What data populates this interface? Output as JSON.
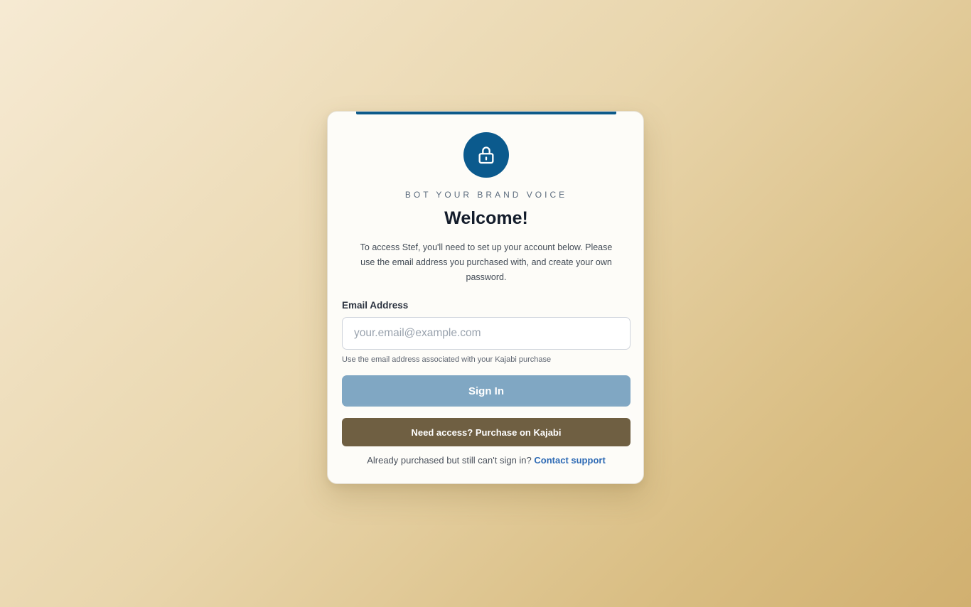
{
  "brand": {
    "tagline": "BOT YOUR BRAND VOICE",
    "accent_color": "#0b5a8d",
    "icon": "lock-icon"
  },
  "welcome": {
    "title": "Welcome!",
    "description": "To access Stef, you'll need to set up your account below. Please use the email address you purchased with, and create your own password."
  },
  "form": {
    "email_label": "Email Address",
    "email_placeholder": "your.email@example.com",
    "email_value": "",
    "email_hint": "Use the email address associated with your Kajabi purchase",
    "signin_label": "Sign In",
    "signin_color": "#80a7c3"
  },
  "purchase": {
    "label": "Need access? Purchase on Kajabi",
    "color": "#6f5f42"
  },
  "support": {
    "prompt": "Already purchased but still can't sign in?",
    "link_label": "Contact support"
  }
}
